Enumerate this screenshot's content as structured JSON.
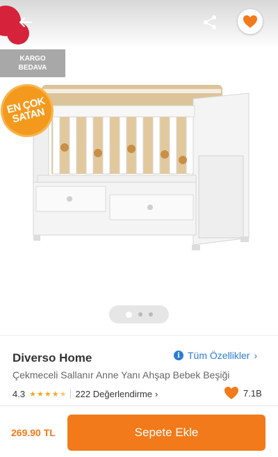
{
  "header": {
    "back_icon": "back-arrow-icon",
    "share_icon": "share-icon",
    "favorite_icon": "heart-icon",
    "accent_color": "#f27a1a"
  },
  "badges": {
    "cargo_line1": "KARGO",
    "cargo_line2": "BEDAVA",
    "bestseller_line1": "EN ÇOK",
    "bestseller_line2": "SATAN"
  },
  "gallery": {
    "total_images": 3,
    "active_index": 0
  },
  "product": {
    "store": "Diverso Home",
    "all_features_label": "Tüm Özellikler",
    "title": "Çekmeceli Sallanır Anne Yanı Ahşap Bebek Beşiği",
    "rating": "4.3",
    "rating_value": 4.3,
    "reviews_label": "222 Değerlendirme",
    "likes": "7.1B"
  },
  "checkout": {
    "price": "269.90 TL",
    "add_to_cart_label": "Sepete Ekle"
  }
}
